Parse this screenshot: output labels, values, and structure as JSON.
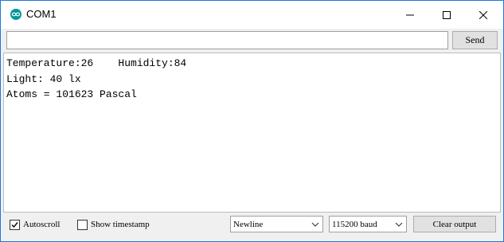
{
  "window": {
    "title": "COM1",
    "icon": "arduino-infinity-icon",
    "accent_color": "#00979c"
  },
  "input": {
    "value": "",
    "send_label": "Send"
  },
  "output": {
    "lines": [
      "Temperature:26    Humidity:84",
      "Light: 40 lx",
      "Atoms = 101623 Pascal"
    ]
  },
  "status_bar": {
    "autoscroll": {
      "label": "Autoscroll",
      "checked": true
    },
    "show_timestamp": {
      "label": "Show timestamp",
      "checked": false
    },
    "line_ending": {
      "value": "Newline"
    },
    "baud_rate": {
      "value": "115200 baud"
    },
    "clear_label": "Clear output"
  }
}
